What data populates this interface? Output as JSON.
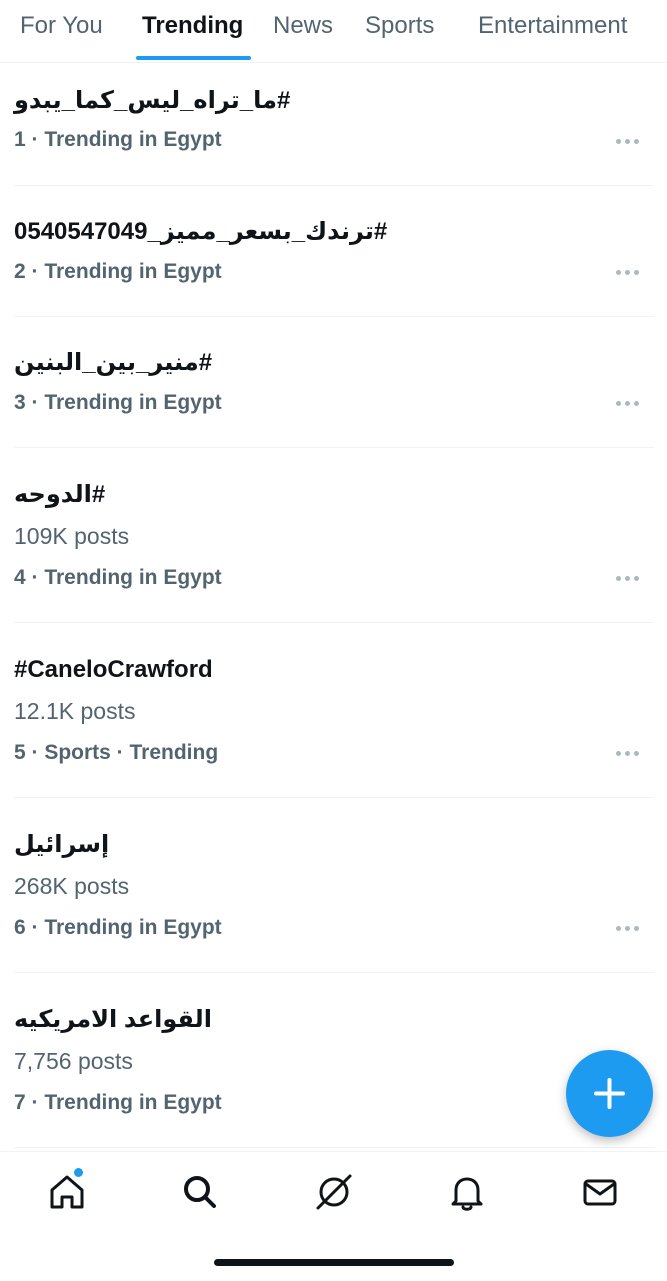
{
  "tabs": [
    {
      "label": "For You"
    },
    {
      "label": "Trending"
    },
    {
      "label": "News"
    },
    {
      "label": "Sports"
    },
    {
      "label": "Entertainment"
    }
  ],
  "active_tab": "Trending",
  "trends": [
    {
      "title": "#ما_تراه_ليس_كما_يبدو",
      "posts": "",
      "meta": "1 · Trending in Egypt"
    },
    {
      "title": "#ترندك_بسعر_مميز_0540547049",
      "posts": "",
      "meta": "2 · Trending in Egypt"
    },
    {
      "title": "#منير_بين_البنين",
      "posts": "",
      "meta": "3 · Trending in Egypt"
    },
    {
      "title": "#الدوحه",
      "posts": "109K posts",
      "meta": "4 · Trending in Egypt"
    },
    {
      "title": "#CaneloCrawford",
      "posts": "12.1K posts",
      "meta": "5 · Sports · Trending"
    },
    {
      "title": "إسرائيل",
      "posts": "268K posts",
      "meta": "6 · Trending in Egypt"
    },
    {
      "title": "القواعد الامريكيه",
      "posts": "7,756 posts",
      "meta": "7 · Trending in Egypt"
    }
  ],
  "icons": {
    "more": "more-icon",
    "fab": "plus-icon",
    "nav": [
      "home-icon",
      "search-icon",
      "grok-icon",
      "notifications-icon",
      "messages-icon"
    ]
  },
  "colors": {
    "accent": "#1d9bf0",
    "text": "#0f1419",
    "muted": "#536471",
    "divider": "#eff3f4"
  }
}
